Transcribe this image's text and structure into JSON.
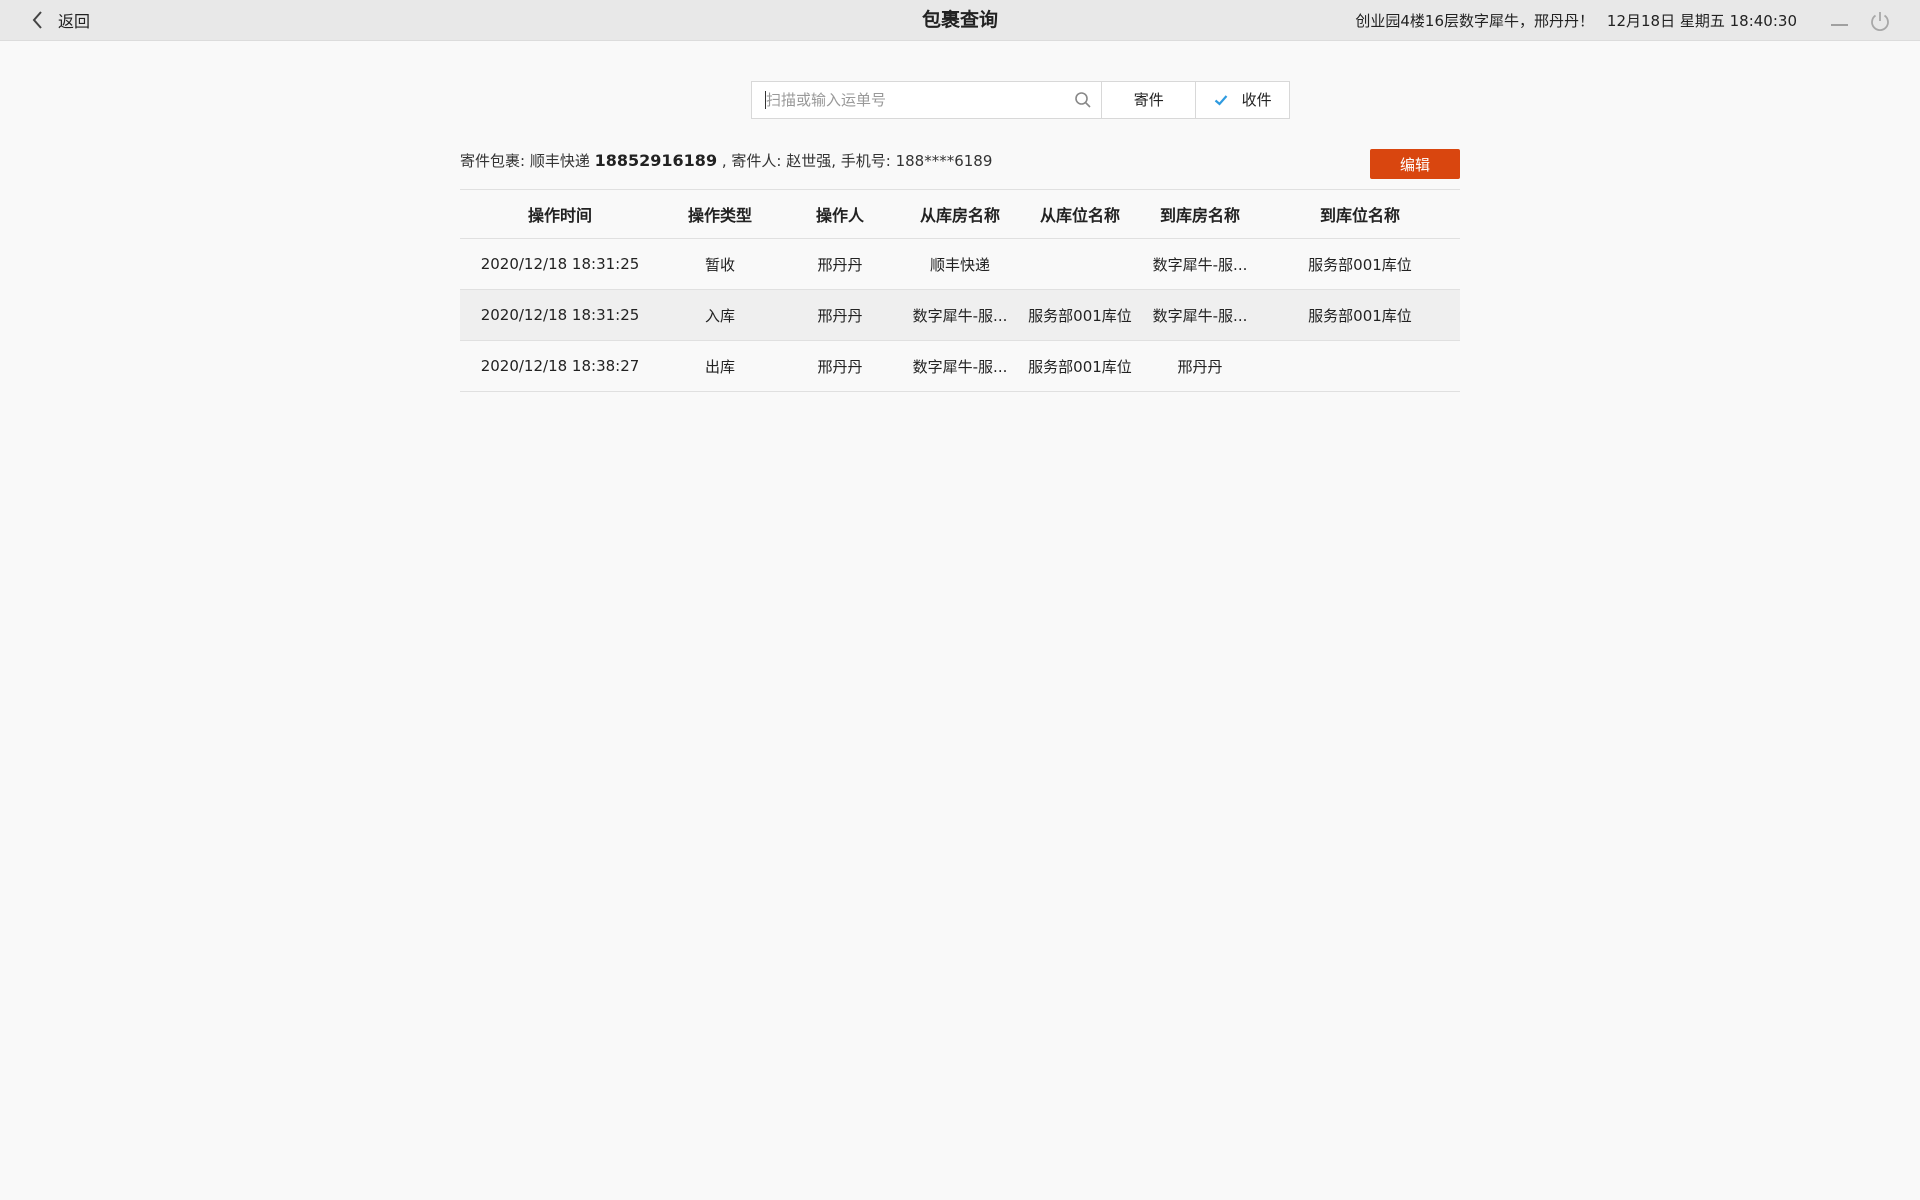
{
  "header": {
    "back_label": "返回",
    "title": "包裹查询",
    "greeting": "创业园4楼16层数字犀牛，邢丹丹！",
    "datetime": "12月18日 星期五 18:40:30"
  },
  "search": {
    "placeholder": "扫描或输入运单号",
    "value": "",
    "mode_send": "寄件",
    "mode_receive": "收件",
    "selected_mode": "收件"
  },
  "package": {
    "prefix": "寄件包裹: 顺丰快递",
    "tracking_no": "18852916189",
    "suffix": ", 寄件人: 赵世强, 手机号: 188****6189"
  },
  "edit_label": "编辑",
  "table": {
    "headers": [
      "操作时间",
      "操作类型",
      "操作人",
      "从库房名称",
      "从库位名称",
      "到库房名称",
      "到库位名称"
    ],
    "rows": [
      [
        "2020/12/18  18:31:25",
        "暂收",
        "邢丹丹",
        "顺丰快递",
        "",
        "数字犀牛-服...",
        "服务部001库位"
      ],
      [
        "2020/12/18  18:31:25",
        "入库",
        "邢丹丹",
        "数字犀牛-服...",
        "服务部001库位",
        "数字犀牛-服...",
        "服务部001库位"
      ],
      [
        "2020/12/18  18:38:27",
        "出库",
        "邢丹丹",
        "数字犀牛-服...",
        "服务部001库位",
        "邢丹丹",
        ""
      ]
    ]
  },
  "colors": {
    "accent": "#d9460f",
    "check": "#2f9be0"
  }
}
